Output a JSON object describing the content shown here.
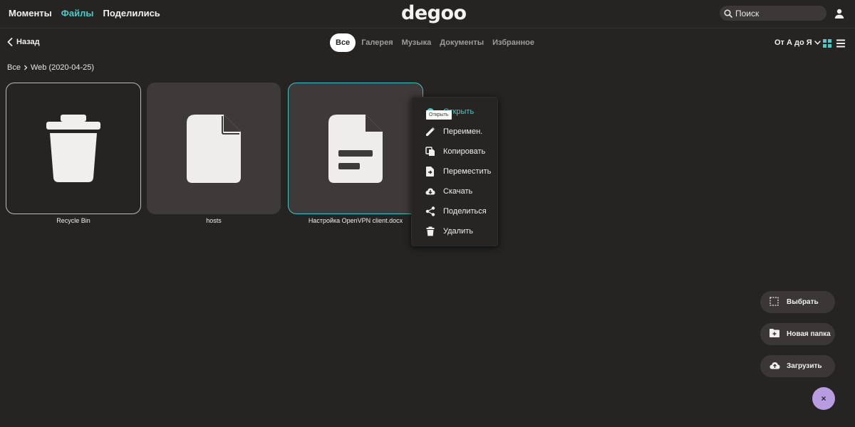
{
  "nav": {
    "links": [
      {
        "label": "Моменты",
        "active": false
      },
      {
        "label": "Файлы",
        "active": true
      },
      {
        "label": "Поделились",
        "active": false
      }
    ],
    "logo": "degoo",
    "search_placeholder": "Поиск"
  },
  "toolbar": {
    "back_label": "Назад",
    "filters": [
      "Все",
      "Галерея",
      "Музыка",
      "Документы",
      "Избранное"
    ],
    "sort_label": "От А до Я"
  },
  "breadcrumb": {
    "root": "Все",
    "current": "Web (2020-04-25)"
  },
  "files": [
    {
      "name": "Recycle Bin",
      "icon": "trash-icon"
    },
    {
      "name": "hosts",
      "icon": "file-icon"
    },
    {
      "name": "Настройка OpenVPN client.docx",
      "icon": "document-icon"
    }
  ],
  "context_menu": {
    "tooltip": "Открыть",
    "items": [
      {
        "label": "Открыть",
        "icon": "open-icon"
      },
      {
        "label": "Переимен.",
        "icon": "pencil-icon"
      },
      {
        "label": "Копировать",
        "icon": "copy-icon"
      },
      {
        "label": "Переместить",
        "icon": "move-icon"
      },
      {
        "label": "Скачать",
        "icon": "download-icon"
      },
      {
        "label": "Поделиться",
        "icon": "share-icon"
      },
      {
        "label": "Удалить",
        "icon": "trash-icon"
      }
    ]
  },
  "actions": {
    "select": "Выбрать",
    "new_folder": "Новая папка",
    "upload": "Загрузить",
    "close": "×"
  },
  "colors": {
    "background": "#252423",
    "accent": "#4fc9c6",
    "tile": "#3f3a3a",
    "fab_close": "#b79de0"
  }
}
